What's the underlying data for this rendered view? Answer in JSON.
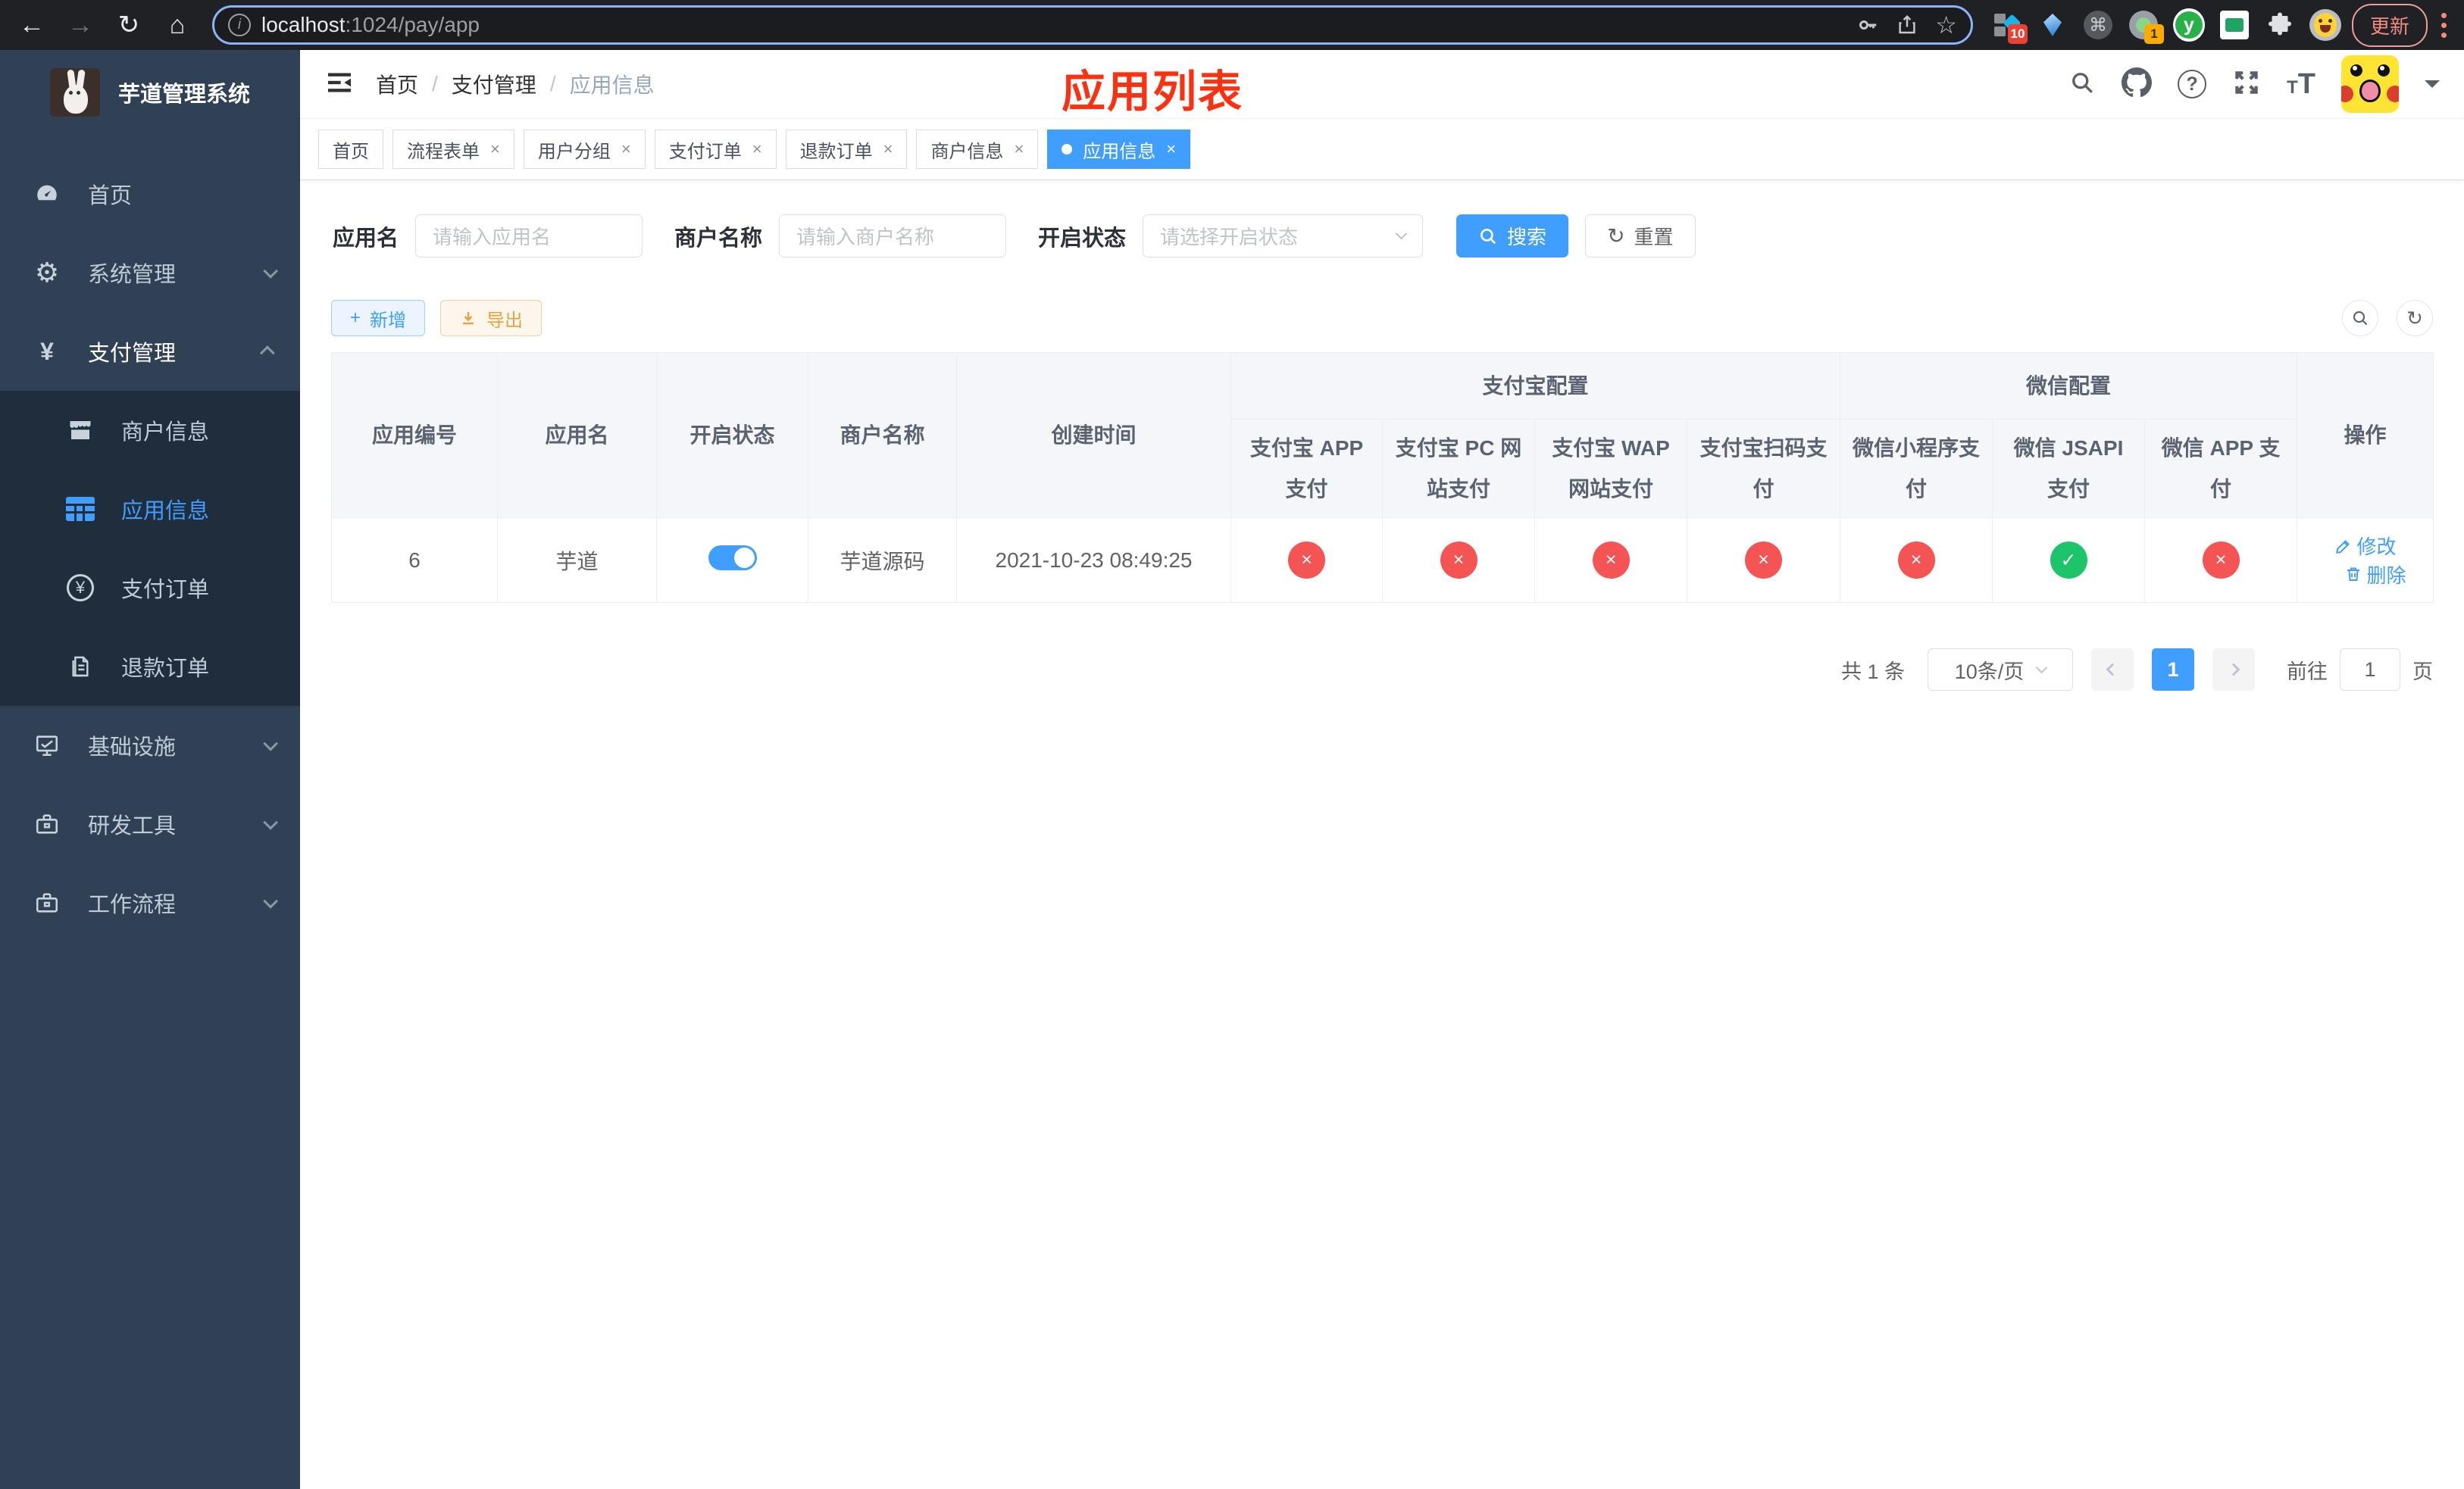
{
  "glyphs": {
    "back": "←",
    "forward": "→",
    "reload": "↻",
    "home": "⌂",
    "star": "☆",
    "command": "⌘",
    "gear": "⚙",
    "yen": "¥",
    "info": "i",
    "question": "?",
    "close": "×",
    "plus": "+",
    "refresh": "↻",
    "y_logo": "y"
  },
  "browser": {
    "url_host": "localhost",
    "url_path": ":1024/pay/app",
    "update_button": "更新",
    "ext_badge_10": "10",
    "ext_badge_1": "1"
  },
  "sidebar": {
    "title": "芋道管理系统",
    "items": [
      {
        "label": "首页"
      },
      {
        "label": "系统管理"
      },
      {
        "label": "支付管理"
      },
      {
        "label": "商户信息"
      },
      {
        "label": "应用信息"
      },
      {
        "label": "支付订单"
      },
      {
        "label": "退款订单"
      },
      {
        "label": "基础设施"
      },
      {
        "label": "研发工具"
      },
      {
        "label": "工作流程"
      }
    ]
  },
  "header": {
    "breadcrumb": [
      "首页",
      "支付管理",
      "应用信息"
    ],
    "separator": "/",
    "annotation": "应用列表"
  },
  "tabs": [
    {
      "label": "首页",
      "closable": false,
      "active": false
    },
    {
      "label": "流程表单",
      "closable": true,
      "active": false
    },
    {
      "label": "用户分组",
      "closable": true,
      "active": false
    },
    {
      "label": "支付订单",
      "closable": true,
      "active": false
    },
    {
      "label": "退款订单",
      "closable": true,
      "active": false
    },
    {
      "label": "商户信息",
      "closable": true,
      "active": false
    },
    {
      "label": "应用信息",
      "closable": true,
      "active": true
    }
  ],
  "filters": {
    "app_name_label": "应用名",
    "app_name_placeholder": "请输入应用名",
    "merchant_label": "商户名称",
    "merchant_placeholder": "请输入商户名称",
    "status_label": "开启状态",
    "status_placeholder": "请选择开启状态",
    "search_button": "搜索",
    "reset_button": "重置"
  },
  "toolbar": {
    "add_button": "新增",
    "export_button": "导出"
  },
  "table": {
    "columns_simple": [
      "应用编号",
      "应用名",
      "开启状态",
      "商户名称",
      "创建时间"
    ],
    "groups": [
      {
        "label": "支付宝配置",
        "children": [
          "支付宝 APP 支付",
          "支付宝 PC 网站支付",
          "支付宝 WAP 网站支付",
          "支付宝扫码支付"
        ]
      },
      {
        "label": "微信配置",
        "children": [
          "微信小程序支付",
          "微信 JSAPI 支付",
          "微信 APP 支付"
        ]
      }
    ],
    "op_column": "操作",
    "row": {
      "id": "6",
      "name": "芋道",
      "enabled": true,
      "merchant": "芋道源码",
      "created": "2021-10-23 08:49:25",
      "statuses": [
        "disabled",
        "disabled",
        "disabled",
        "disabled",
        "disabled",
        "enabled",
        "disabled"
      ],
      "edit_label": "修改",
      "delete_label": "删除"
    }
  },
  "pagination": {
    "total_label": "共 1 条",
    "page_size": "10条/页",
    "current_page": "1",
    "goto_label": "前往",
    "goto_value": "1",
    "page_unit": "页"
  }
}
